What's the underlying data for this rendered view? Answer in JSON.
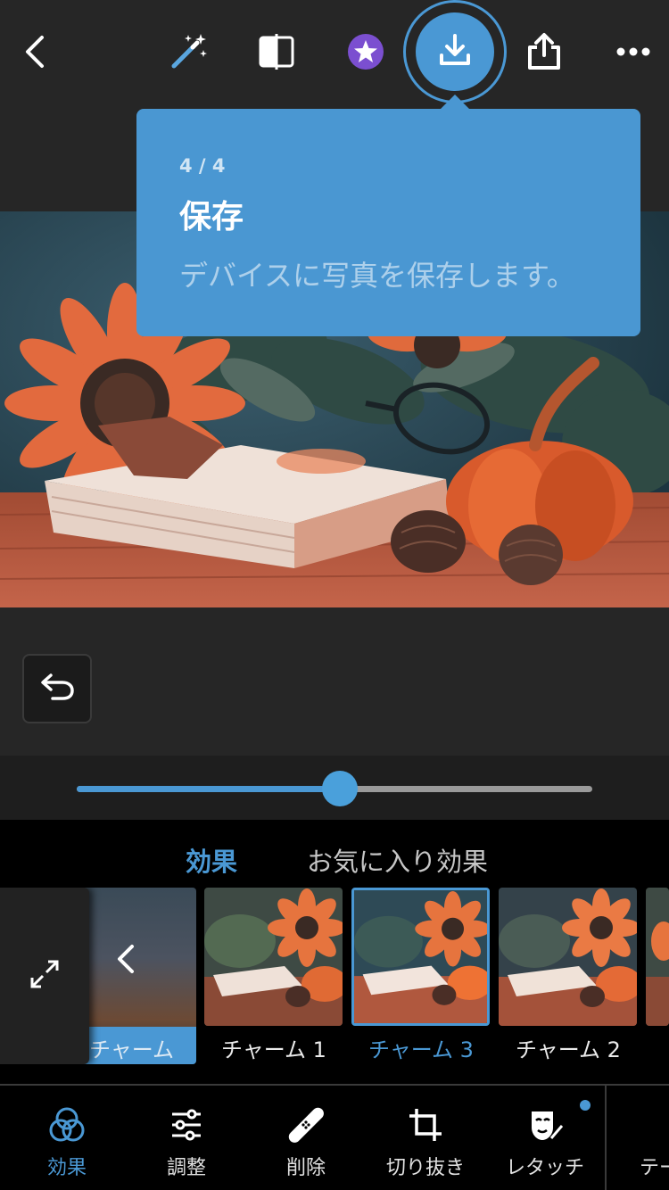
{
  "toolbar": {
    "icons": [
      "back-icon",
      "magic-wand-icon",
      "compare-icon",
      "premium-star-icon",
      "download-icon",
      "share-icon",
      "more-icon"
    ]
  },
  "tooltip": {
    "step": "4 / 4",
    "title": "保存",
    "description": "デバイスに写真を保存します。"
  },
  "slider": {
    "value": 0.51
  },
  "effects": {
    "tabs": [
      "効果",
      "お気に入り効果"
    ],
    "active_tab": "効果",
    "previous_label": "チャーム",
    "items": [
      {
        "label": "チャーム 1",
        "selected": false
      },
      {
        "label": "チャーム 3",
        "selected": true
      },
      {
        "label": "チャーム 2",
        "selected": false
      }
    ]
  },
  "nav": {
    "items": [
      {
        "label": "効果",
        "icon": "effects-circles-icon",
        "active": true
      },
      {
        "label": "調整",
        "icon": "adjust-sliders-icon",
        "active": false
      },
      {
        "label": "削除",
        "icon": "bandage-icon",
        "active": false
      },
      {
        "label": "切り抜き",
        "icon": "crop-icon",
        "active": false
      },
      {
        "label": "レタッチ",
        "icon": "retouch-face-icon",
        "active": false
      },
      {
        "label": "テー",
        "icon": "gear-icon",
        "active": false
      }
    ]
  },
  "colors": {
    "accent": "#4a98d4",
    "background": "#262626",
    "panel": "#000000"
  }
}
